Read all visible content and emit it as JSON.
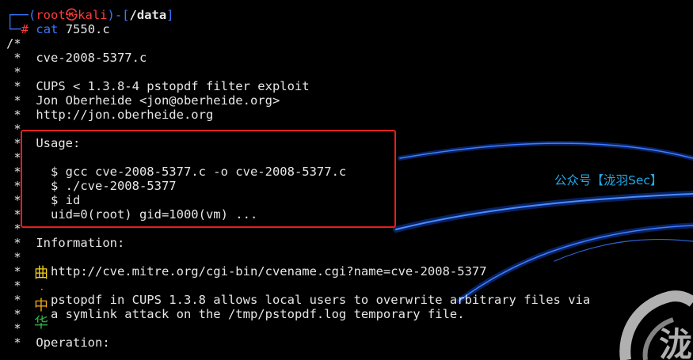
{
  "prompt": {
    "user": "root",
    "host": "kali",
    "skull": "㉿",
    "path": "/data",
    "hash": "#",
    "command": "cat",
    "argument": "7550.c"
  },
  "file_lines": [
    "/*",
    " *  cve-2008-5377.c",
    " *",
    " *  CUPS < 1.3.8-4 pstopdf filter exploit",
    " *  Jon Oberheide <jon@oberheide.org>",
    " *  http://jon.oberheide.org",
    " *",
    " *  Usage:",
    " *",
    " *    $ gcc cve-2008-5377.c -o cve-2008-5377.c",
    " *    $ ./cve-2008-5377",
    " *    $ id",
    " *    uid=0(root) gid=1000(vm) ...",
    " *",
    " *  Information:",
    " *",
    " *    http://cve.mitre.org/cgi-bin/cvename.cgi?name=cve-2008-5377",
    " *",
    " *    pstopdf in CUPS 1.3.8 allows local users to overwrite arbitrary files via",
    " *    a symlink attack on the /tmp/pstopdf.log temporary file.",
    " *",
    " *  Operation:"
  ],
  "watermark_text": "公众号【泷羽Sec】",
  "stamp_chars": [
    "曲",
    "·",
    "中",
    "华"
  ],
  "colors": {
    "background": "#000000",
    "text": "#e6e6e6",
    "prompt_blue": "#3b78ff",
    "prompt_red": "#ff3b3b",
    "highlight_border": "#e02020",
    "watermark": "#21a9e8"
  }
}
